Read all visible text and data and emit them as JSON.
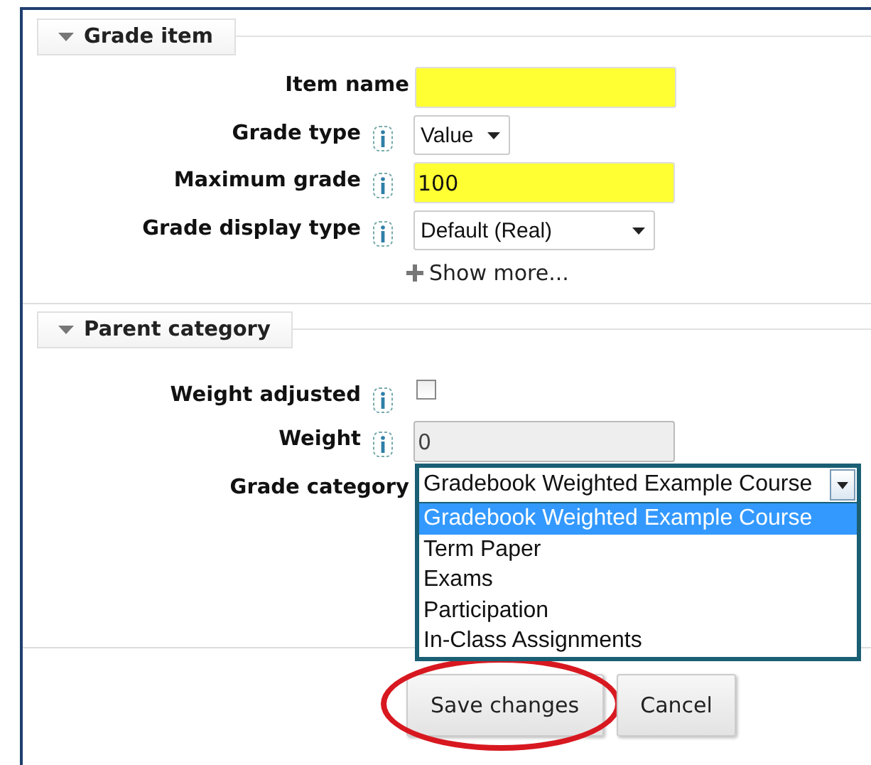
{
  "sections": [
    {
      "legend": "Grade item",
      "expanded": true,
      "more_link": "Show more...",
      "fields": [
        {
          "label": "Item name",
          "kind": "text",
          "help": false,
          "highlighted": true
        },
        {
          "label": "Grade type",
          "kind": "select",
          "help": true,
          "value": "Value"
        },
        {
          "label": "Maximum grade",
          "kind": "text",
          "help": true,
          "highlighted": true,
          "value": "100"
        },
        {
          "label": "Grade display type",
          "kind": "select",
          "help": true,
          "value": "Default (Real)"
        }
      ]
    },
    {
      "legend": "Parent category",
      "expanded": true,
      "fields": [
        {
          "label": "Weight adjusted",
          "kind": "checkbox",
          "help": true,
          "checked": false
        },
        {
          "label": "Weight",
          "kind": "text",
          "help": true,
          "disabled": true,
          "value": "0"
        },
        {
          "label": "Grade category",
          "kind": "open-select",
          "help": false,
          "value": "Gradebook Weighted Example Course",
          "options": [
            {
              "label": "Gradebook Weighted Example Course",
              "selected": true
            },
            {
              "label": "Term Paper",
              "selected": false
            },
            {
              "label": "Exams",
              "selected": false
            },
            {
              "label": "Participation",
              "selected": false
            },
            {
              "label": "In-Class Assignments",
              "selected": false
            }
          ]
        }
      ]
    }
  ],
  "buttons": [
    {
      "label": "Save changes",
      "circled": true
    },
    {
      "label": "Cancel",
      "circled": false
    }
  ]
}
